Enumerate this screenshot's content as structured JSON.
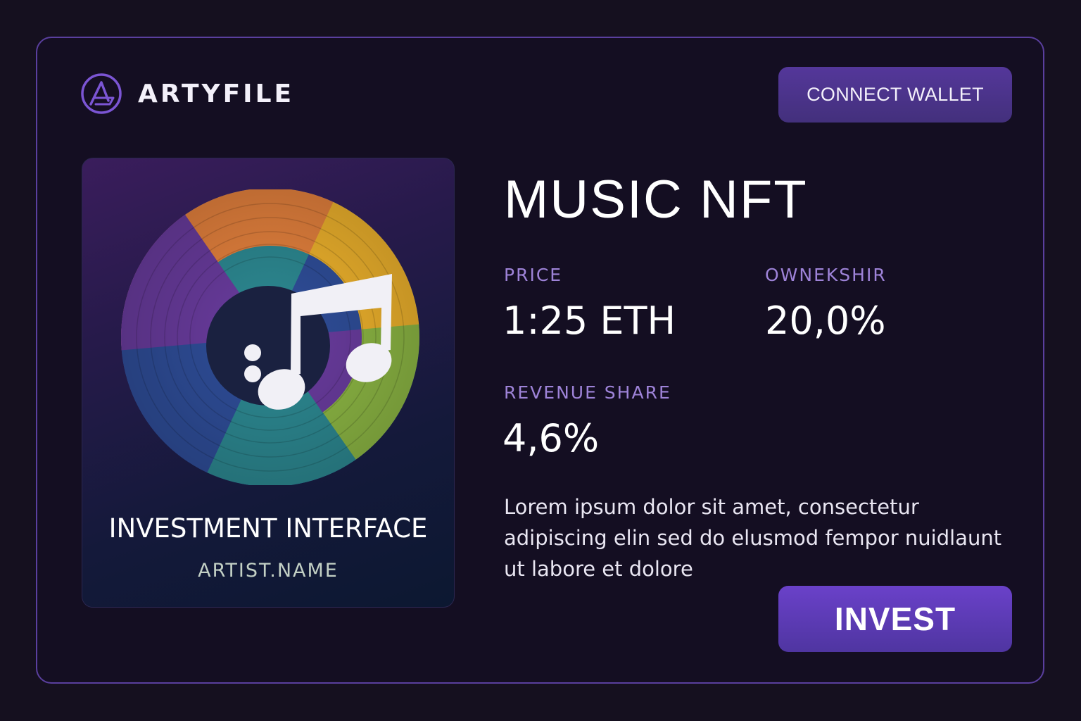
{
  "brand": {
    "logo_icon": "artyfile-logo-icon",
    "name": "ARTYFILE",
    "accent": "#7b55d4"
  },
  "header": {
    "connect_label": "CONNECT WALLET"
  },
  "card": {
    "art_icon": "music-note-icon",
    "title": "INVESTMENT INTERFACE",
    "artist": "ARTIST.NAME"
  },
  "main": {
    "title": "MUSIC NFT",
    "price": {
      "label": "PRICE",
      "value": "1:25 ETH"
    },
    "ownership": {
      "label": "OWNEKSHIR",
      "value": "20,0%"
    },
    "revenue": {
      "label": "REVENUE SHARE",
      "value": "4,6%"
    },
    "description": "Lorem ipsum dolor sit amet, consectetur adipiscing elin sed do elusmod fempor nuidlaunt ut labore et dolore",
    "invest_label": "INVEST"
  },
  "colors": {
    "background": "#15101f",
    "frame_border": "#5a3f9e",
    "label": "#9e83d8",
    "button": "#54379a",
    "invest_button": "#6a41c9"
  }
}
